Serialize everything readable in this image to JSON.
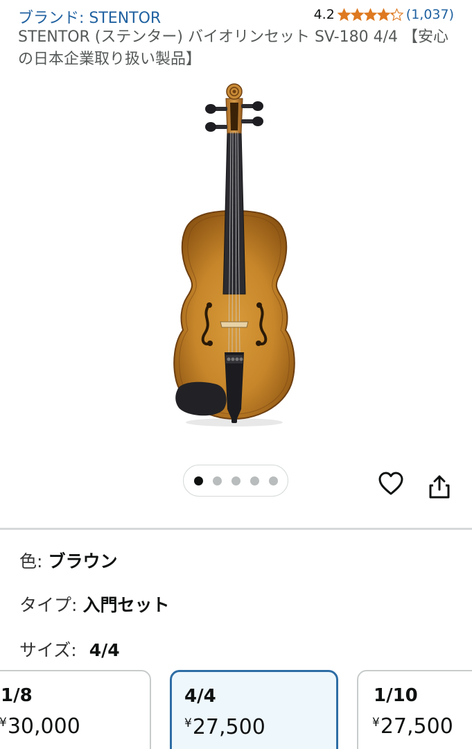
{
  "header": {
    "brand": "ブランド: STENTOR",
    "rating_value": "4.2",
    "rating_stars": 4.2,
    "rating_count": "(1,037)"
  },
  "product": {
    "title": "STENTOR (ステンター) バイオリンセット SV-180 4/4 【安心の日本企業取り扱い製品】"
  },
  "carousel": {
    "total": 5,
    "active_index": 0
  },
  "variations": {
    "color_label": "色:",
    "color_value": "ブラウン",
    "type_label": "タイプ:",
    "type_value": "入門セット",
    "size_label": "サイズ:",
    "size_value": "4/4"
  },
  "sizes": [
    {
      "name": "1/8",
      "currency": "¥",
      "price": "30,000",
      "selected": false
    },
    {
      "name": "4/4",
      "currency": "¥",
      "price": "27,500",
      "selected": true
    },
    {
      "name": "1/10",
      "currency": "¥",
      "price": "27,500",
      "selected": false
    }
  ],
  "colors": {
    "link": "#2162a1",
    "star": "#de7921",
    "selected_border": "#2d6da5",
    "selected_bg": "#eef7fc"
  },
  "icons": {
    "wishlist": "heart-icon",
    "share": "share-icon"
  }
}
